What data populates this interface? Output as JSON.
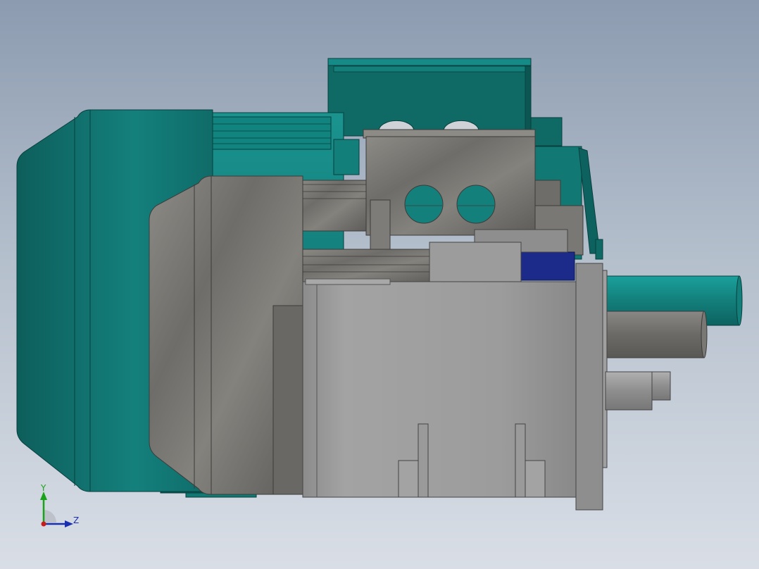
{
  "viewport": {
    "triad": {
      "y_label": "Y",
      "z_label": "Z"
    },
    "colors": {
      "teal": "#168a86",
      "teal_dark": "#0e5f5c",
      "stone": "#7a7874",
      "grey": "#9a9a9a",
      "navy": "#1c2a8a",
      "axis_y": "#1aa31a",
      "axis_z": "#1a2fb0",
      "axis_x": "#cc1a1a"
    }
  }
}
